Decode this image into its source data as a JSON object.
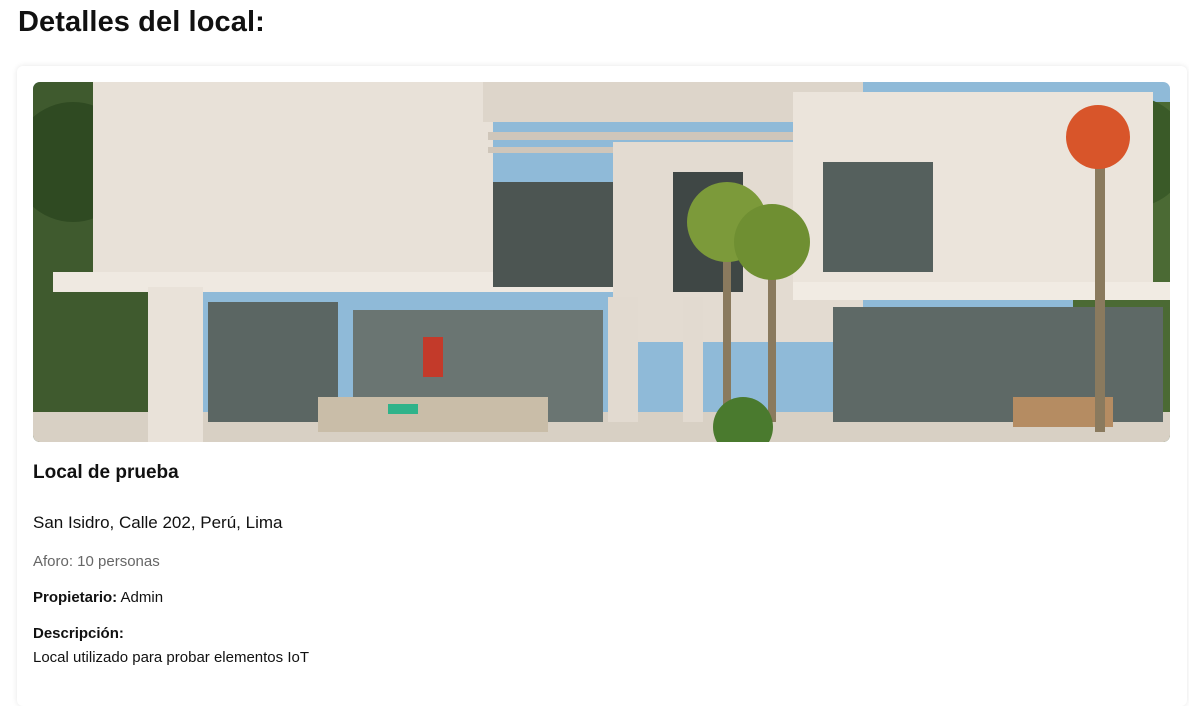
{
  "page": {
    "title": "Detalles del local:"
  },
  "venue": {
    "image_alt": "Fotografía del local",
    "name": "Local de prueba",
    "address": "San Isidro, Calle 202, Perú, Lima",
    "capacity": "Aforo: 10 personas",
    "owner_label": "Propietario:",
    "owner_value": "Admin",
    "description_label": "Descripción:",
    "description_text": "Local utilizado para probar elementos IoT"
  }
}
